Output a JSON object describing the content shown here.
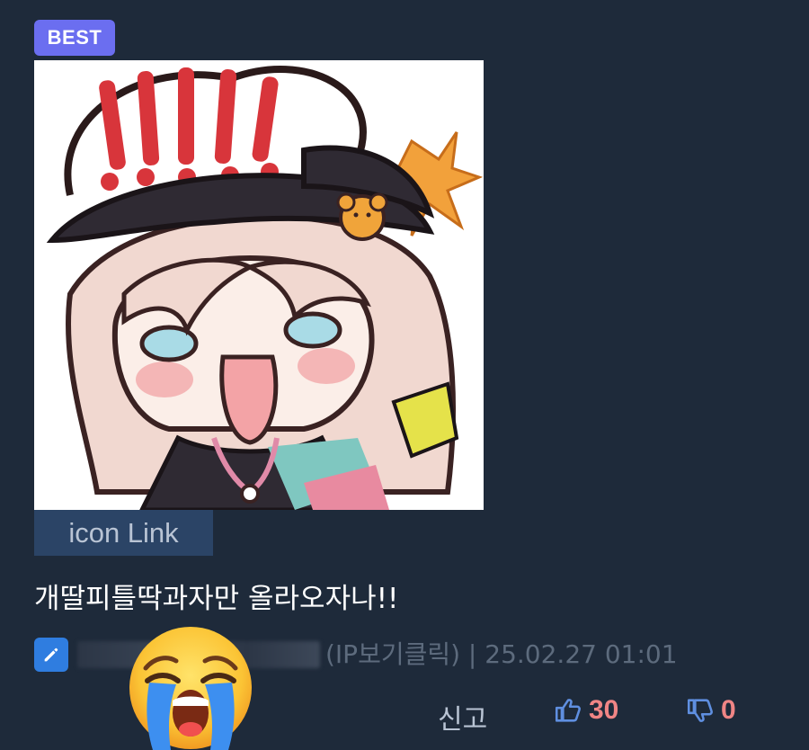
{
  "comment": {
    "badge": "BEST",
    "image_link_label": "icon Link",
    "text": "개딸피틀딱과자만 올라오자나!!",
    "meta": "(IP보기클릭) | 25.02.27 01:01",
    "actions": {
      "report_label": "신고",
      "like_count": "30",
      "dislike_count": "0"
    }
  },
  "colors": {
    "background": "#1e2a3a",
    "badge": "#6b6ef0",
    "link_bg": "#2b4466",
    "count": "#f08585",
    "accent": "#2f7de0"
  },
  "icons": {
    "edit": "pencil-icon",
    "like": "thumbs-up-icon",
    "dislike": "thumbs-down-icon",
    "overlay": "loudly-crying-face-emoji"
  }
}
